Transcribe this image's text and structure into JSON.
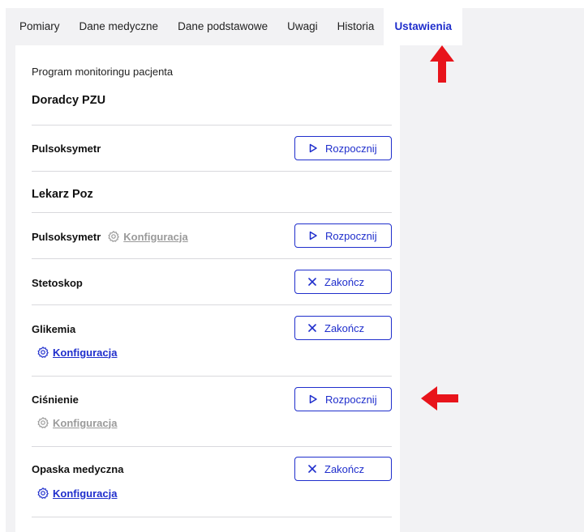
{
  "tabs": [
    {
      "label": "Pomiary"
    },
    {
      "label": "Dane medyczne"
    },
    {
      "label": "Dane podstawowe"
    },
    {
      "label": "Uwagi"
    },
    {
      "label": "Historia"
    },
    {
      "label": "Ustawienia",
      "active": true
    }
  ],
  "program": {
    "label": "Program monitoringu pacjenta",
    "groups": [
      {
        "title": "Doradcy PZU",
        "devices": [
          {
            "name": "Pulsoksymetr",
            "action": "Rozpocznij"
          }
        ]
      },
      {
        "title": "Lekarz Poz",
        "devices": [
          {
            "name": "Pulsoksymetr",
            "config": "Konfiguracja",
            "action": "Rozpocznij"
          },
          {
            "name": "Stetoskop",
            "action": "Zakończ"
          },
          {
            "name": "Glikemia",
            "config": "Konfiguracja",
            "action": "Zakończ"
          },
          {
            "name": "Ciśnienie",
            "config": "Konfiguracja",
            "action": "Rozpocznij"
          },
          {
            "name": "Opaska medyczna",
            "config": "Konfiguracja",
            "action": "Zakończ"
          }
        ]
      }
    ]
  },
  "colors": {
    "accent": "#1f2ecc",
    "annotation": "#e8141b",
    "disabled": "#9a9a9a"
  },
  "icons": {
    "start": "play-triangle-icon",
    "stop": "x-icon",
    "config": "gear-icon",
    "annotation": "red-arrow-icon"
  }
}
